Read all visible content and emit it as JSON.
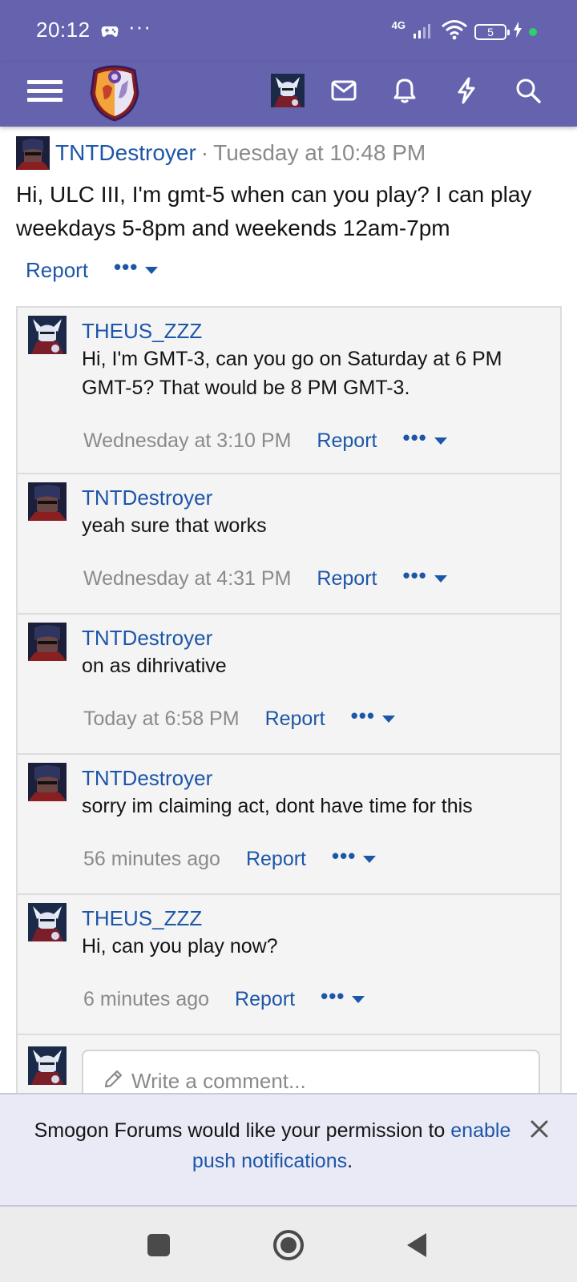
{
  "status_bar": {
    "time": "20:12",
    "dots": "···",
    "network": "4G",
    "battery": "5"
  },
  "header": {
    "icons": [
      "menu-icon",
      "forum-logo",
      "user-avatar",
      "envelope-icon",
      "bell-icon",
      "lightning-icon",
      "search-icon"
    ]
  },
  "post": {
    "username": "TNTDestroyer",
    "separator": "·",
    "time": "Tuesday at 10:48 PM",
    "body": "Hi, ULC III, I'm gmt-5 when can you play? I can play weekdays 5-8pm and weekends 12am-7pm",
    "report": "Report",
    "more": "•••"
  },
  "comments": [
    {
      "username": "THEUS_ZZZ",
      "text": "Hi, I'm GMT-3, can you go on Saturday at 6 PM GMT-5? That would be 8 PM GMT-3.",
      "time": "Wednesday at 3:10 PM",
      "report": "Report",
      "more": "•••"
    },
    {
      "username": "TNTDestroyer",
      "text": "yeah sure that works",
      "time": "Wednesday at 4:31 PM",
      "report": "Report",
      "more": "•••"
    },
    {
      "username": "TNTDestroyer",
      "text": "on as dihrivative",
      "time": "Today at 6:58 PM",
      "report": "Report",
      "more": "•••"
    },
    {
      "username": "TNTDestroyer",
      "text": "sorry im claiming act, dont have time for this",
      "time": "56 minutes ago",
      "report": "Report",
      "more": "•••"
    },
    {
      "username": "THEUS_ZZZ",
      "text": "Hi, can you play now?",
      "time": "6 minutes ago",
      "report": "Report",
      "more": "•••"
    }
  ],
  "comment_input": {
    "placeholder": "Write a comment..."
  },
  "push_banner": {
    "text_before": "Smogon Forums would like your permission to ",
    "link": "enable push notifications",
    "text_after": "."
  },
  "colors": {
    "header_bg": "#6563ae",
    "link": "#1d56a8",
    "muted": "#8a8a8a",
    "comment_bg": "#f4f4f4"
  }
}
